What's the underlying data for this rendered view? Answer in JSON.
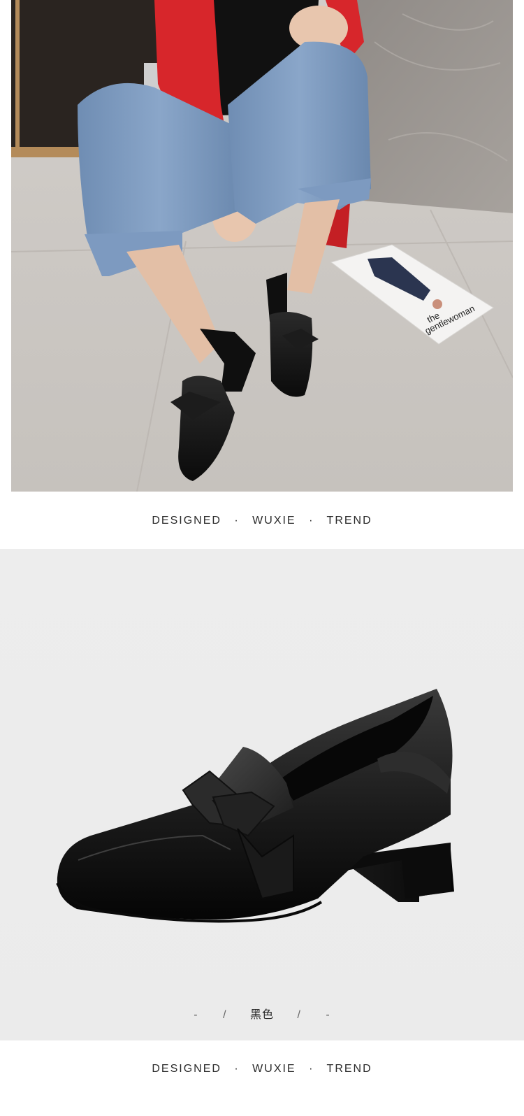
{
  "top_photo": {
    "magazine_text_line1": "the",
    "magazine_text_line2": "gentlewoman"
  },
  "tagline": {
    "part1": "DESIGNED",
    "part2": "WUXIE",
    "part3": "TREND",
    "separator": "·"
  },
  "product": {
    "color_name": "黑色",
    "dash": "-",
    "slash": "/"
  },
  "colors": {
    "jacket": "#d7262b",
    "jeans": "#7a98be",
    "shoe": "#121212",
    "floor": "#cfcac5",
    "product_bg": "#ececec"
  }
}
